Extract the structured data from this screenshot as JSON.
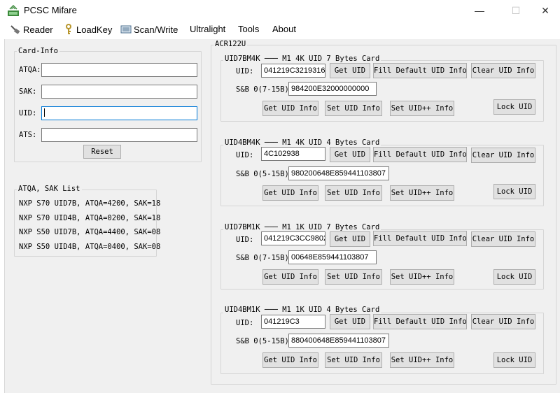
{
  "window": {
    "title": "PCSC Mifare",
    "minimize": "—",
    "maximize": "☐",
    "close": "✕"
  },
  "menu": [
    {
      "label": "Reader",
      "icon": "reader-icon"
    },
    {
      "label": "LoadKey",
      "icon": "key-icon"
    },
    {
      "label": "Scan/Write",
      "icon": "scanner-icon"
    },
    {
      "label": "Ultralight"
    },
    {
      "label": "Tools"
    },
    {
      "label": "About"
    }
  ],
  "card_info": {
    "title": "Card-Info",
    "atqa_label": "ATQA:",
    "atqa_value": "",
    "sak_label": "SAK:",
    "sak_value": "",
    "uid_label": "UID:",
    "uid_value": "",
    "ats_label": "ATS:",
    "ats_value": "",
    "reset_button": "Reset"
  },
  "atqa_list": {
    "title": "ATQA, SAK List",
    "lines": [
      "NXP S70 UID7B, ATQA=4200, SAK=18",
      "NXP S70 UID4B, ATQA=0200, SAK=18",
      "NXP S50 UID7B, ATQA=4400, SAK=08",
      "NXP S50 UID4B, ATQA=0400, SAK=08"
    ]
  },
  "reader": {
    "title": "ACR122U",
    "groups": [
      {
        "title": "UID7BM4K",
        "desc": "M1 4K UID 7 Bytes Card",
        "uid_label": "UID:",
        "uid_value": "041219C3219316",
        "get_uid": "Get UID",
        "fill": "Fill Default UID Info",
        "clear": "Clear UID Info",
        "sb_label": "S&B 0(7-15B):",
        "sb_value": "984200E32000000000",
        "get_info": "Get UID Info",
        "set_info": "Set UID Info",
        "set_pp": "Set UID++ Info",
        "lock": "Lock UID"
      },
      {
        "title": "UID4BM4K",
        "desc": "M1 4K UID 4 Bytes Card",
        "uid_label": "UID:",
        "uid_value": "4C102938",
        "get_uid": "Get UID",
        "fill": "Fill Default UID Info",
        "clear": "Clear UID Info",
        "sb_label": "S&B 0(5-15B):",
        "sb_value": "980200648E859441103807",
        "get_info": "Get UID Info",
        "set_info": "Set UID Info",
        "set_pp": "Set UID++ Info",
        "lock": "Lock UID"
      },
      {
        "title": "UID7BM1K",
        "desc": "M1 1K UID 7 Bytes Card",
        "uid_label": "UID:",
        "uid_value": "041219C3CC9802",
        "get_uid": "Get UID",
        "fill": "Fill Default UID Info",
        "clear": "Clear UID Info",
        "sb_label": "S&B 0(7-15B):",
        "sb_value": "00648E859441103807",
        "get_info": "Get UID Info",
        "set_info": "Set UID Info",
        "set_pp": "Set UID++ Info",
        "lock": "Lock UID"
      },
      {
        "title": "UID4BM1K",
        "desc": "M1 1K UID 4 Bytes Card",
        "uid_label": "UID:",
        "uid_value": "041219C3",
        "get_uid": "Get UID",
        "fill": "Fill Default UID Info",
        "clear": "Clear UID Info",
        "sb_label": "S&B 0(5-15B):",
        "sb_value": "880400648E859441103807",
        "get_info": "Get UID Info",
        "set_info": "Set UID Info",
        "set_pp": "Set UID++ Info",
        "lock": "Lock UID"
      }
    ]
  }
}
